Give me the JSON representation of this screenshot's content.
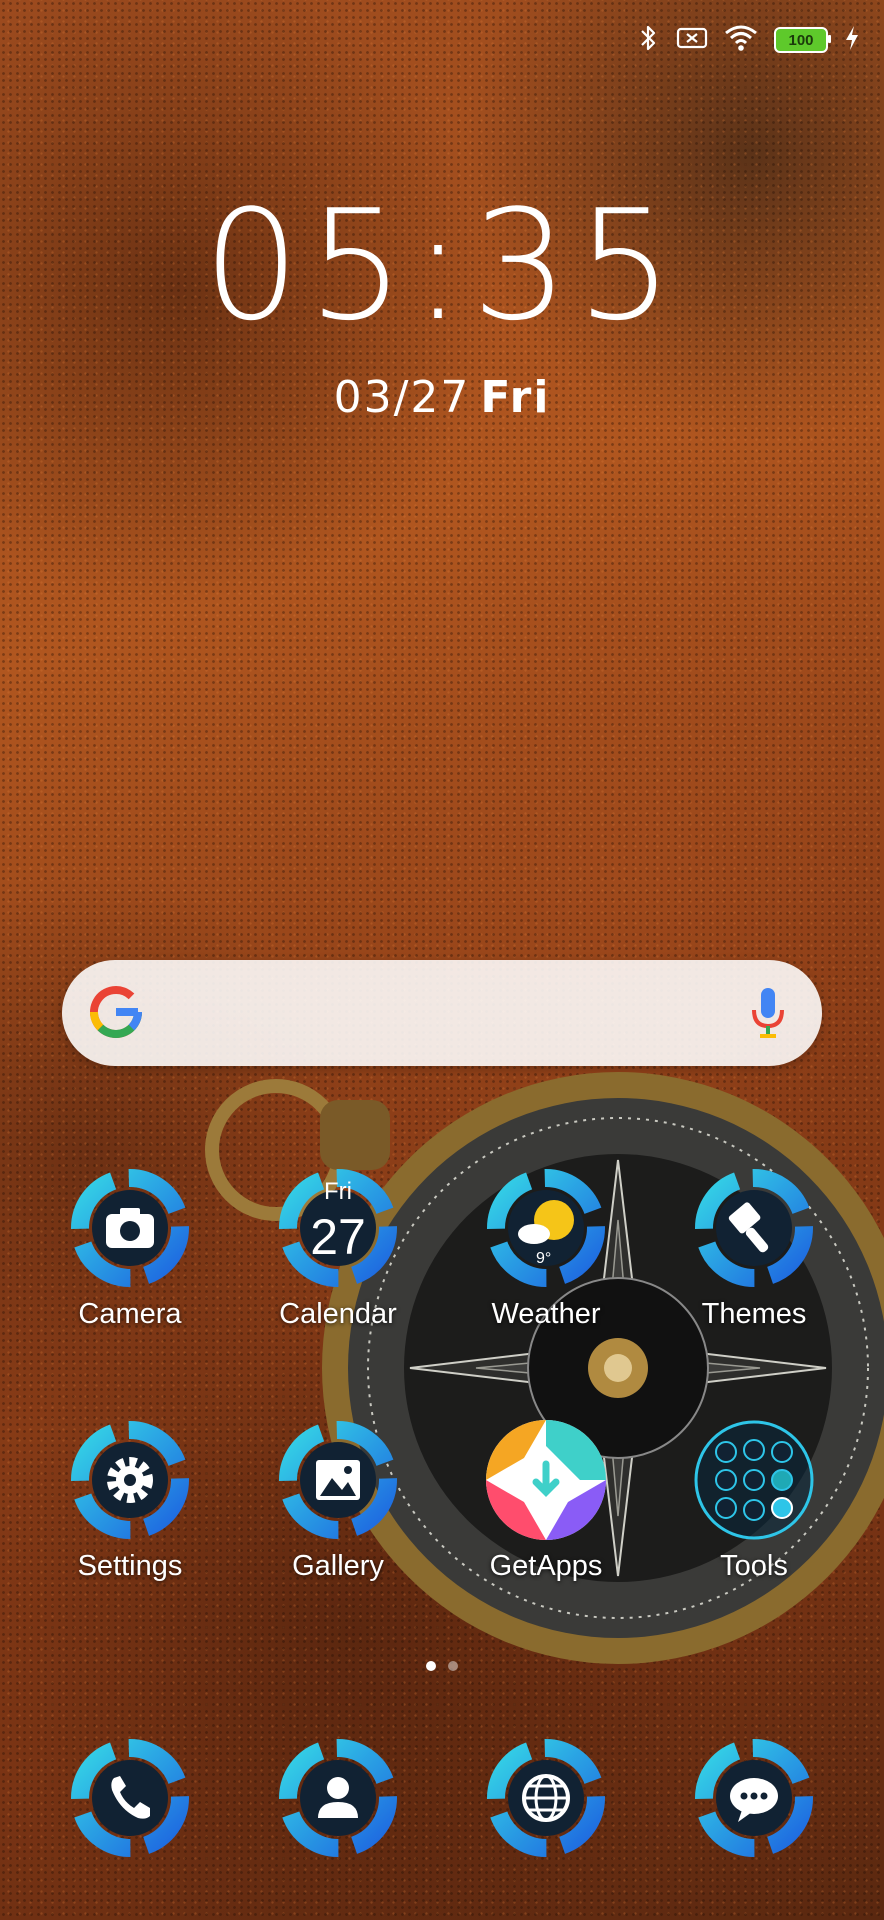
{
  "status_bar": {
    "battery_level": "100",
    "icons": [
      "bluetooth-icon",
      "no-sim-icon",
      "wifi-icon",
      "battery-icon",
      "charging-icon"
    ]
  },
  "lock_clock": {
    "time": "05:35",
    "date": "03/27",
    "weekday": "Fri"
  },
  "search_bar": {
    "icons": [
      "google-logo-icon",
      "microphone-icon"
    ]
  },
  "apps_row1": [
    {
      "label": "Camera",
      "icon": "camera-icon"
    },
    {
      "label": "Calendar",
      "icon": "calendar-icon",
      "day": "Fri",
      "date": "27"
    },
    {
      "label": "Weather",
      "icon": "weather-icon",
      "temperature": "9°"
    },
    {
      "label": "Themes",
      "icon": "paintbrush-icon"
    }
  ],
  "apps_row2": [
    {
      "label": "Settings",
      "icon": "gear-icon"
    },
    {
      "label": "Gallery",
      "icon": "image-icon"
    },
    {
      "label": "GetApps",
      "icon": "getapps-icon"
    },
    {
      "label": "Tools",
      "icon": "folder-icon"
    }
  ],
  "dock": [
    {
      "icon": "phone-icon"
    },
    {
      "icon": "contacts-icon"
    },
    {
      "icon": "browser-globe-icon"
    },
    {
      "icon": "messages-icon"
    }
  ],
  "home_pages": {
    "count": 2,
    "active": 1
  },
  "colors": {
    "icon_ring_start": "#2ec5e8",
    "icon_ring_end": "#1e6fe0",
    "battery": "#5ec92b"
  }
}
